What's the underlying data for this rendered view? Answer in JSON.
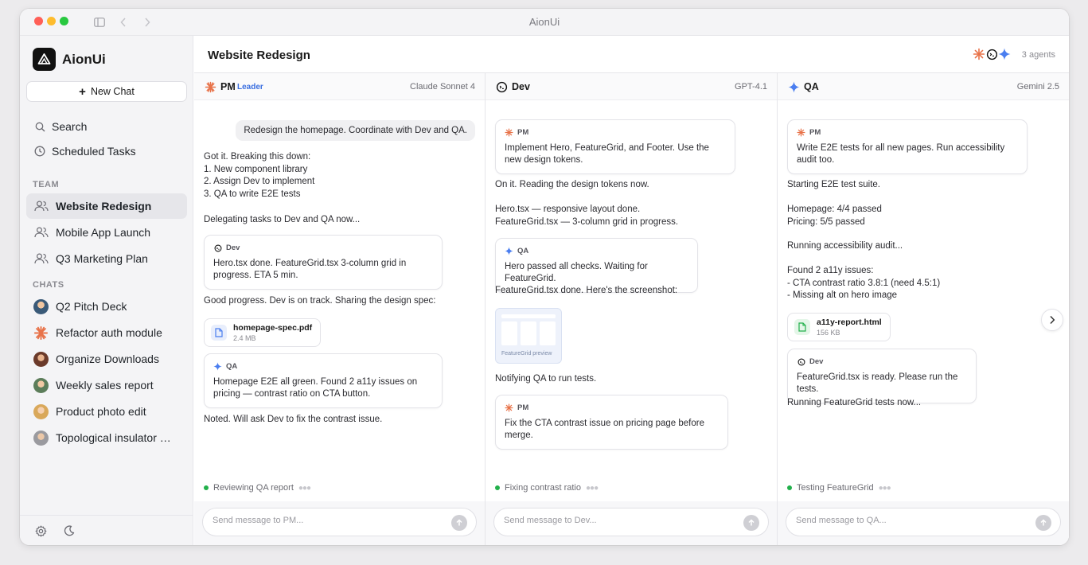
{
  "window": {
    "title": "AionUi"
  },
  "sidebar": {
    "brand": "AionUi",
    "new_chat": "New Chat",
    "nav": [
      {
        "label": "Search",
        "icon": "search-icon"
      },
      {
        "label": "Scheduled Tasks",
        "icon": "clock-icon"
      }
    ],
    "team_label": "TEAM",
    "teams": [
      {
        "label": "Website Redesign",
        "active": true
      },
      {
        "label": "Mobile App Launch"
      },
      {
        "label": "Q3 Marketing Plan"
      }
    ],
    "chats_label": "CHATS",
    "chats": [
      {
        "label": "Q2 Pitch Deck",
        "avatar": "avatar-man"
      },
      {
        "label": "Refactor auth module",
        "avatar": "claude-icon"
      },
      {
        "label": "Organize Downloads",
        "avatar": "avatar-woman"
      },
      {
        "label": "Weekly sales report",
        "avatar": "avatar-glasses"
      },
      {
        "label": "Product photo edit",
        "avatar": "avatar-blonde"
      },
      {
        "label": "Topological insulator p…",
        "avatar": "avatar-elder"
      }
    ]
  },
  "main": {
    "title": "Website Redesign",
    "agents_count": "3 agents",
    "columns": [
      {
        "name": "PM",
        "badge": "Leader",
        "model": "Claude Sonnet 4",
        "user_message": "Redesign the homepage. Coordinate with Dev and QA.",
        "m1": "Got it. Breaking this down:\n1. New component library\n2. Assign Dev to implement\n3. QA to write E2E tests",
        "m2": "Delegating tasks to Dev and QA now...",
        "b1_from": "Dev",
        "b1_text": "Hero.tsx done. FeatureGrid.tsx 3-column grid in progress. ETA 5 min.",
        "m3": "Good progress. Dev is on track. Sharing the design spec:",
        "file_name": "homepage-spec.pdf",
        "file_size": "2.4 MB",
        "b2_from": "QA",
        "b2_text": "Homepage E2E all green. Found 2 a11y issues on pricing — contrast ratio on CTA button.",
        "m4": "Noted. Will ask Dev to fix the contrast issue.",
        "status": "Reviewing QA report",
        "placeholder": "Send message to PM..."
      },
      {
        "name": "Dev",
        "model": "GPT-4.1",
        "b1_from": "PM",
        "b1_text": "Implement Hero, FeatureGrid, and Footer. Use the new design tokens.",
        "m1": "On it. Reading the design tokens now.",
        "m2": "Hero.tsx — responsive layout done.\nFeatureGrid.tsx — 3-column grid in progress.",
        "b2_from": "QA",
        "b2_text": "Hero passed all checks. Waiting for FeatureGrid.",
        "m3": "FeatureGrid.tsx done. Here's the screenshot:",
        "image_caption": "FeatureGrid preview",
        "m4": "Notifying QA to run tests.",
        "b3_from": "PM",
        "b3_text": "Fix the CTA contrast issue on pricing page before merge.",
        "status": "Fixing contrast ratio",
        "placeholder": "Send message to Dev..."
      },
      {
        "name": "QA",
        "model": "Gemini 2.5",
        "b1_from": "PM",
        "b1_text": "Write E2E tests for all new pages. Run accessibility audit too.",
        "m1": "Starting E2E test suite.",
        "m2": "Homepage: 4/4 passed\nPricing: 5/5 passed",
        "m3": "Running accessibility audit...",
        "m4": "Found 2 a11y issues:\n- CTA contrast ratio 3.8:1 (need 4.5:1)\n- Missing alt on hero image",
        "file_name": "a11y-report.html",
        "file_size": "156 KB",
        "b2_from": "Dev",
        "b2_text": "FeatureGrid.tsx is ready. Please run the tests.",
        "m5": "Running FeatureGrid tests now...",
        "status": "Testing FeatureGrid",
        "placeholder": "Send message to QA..."
      }
    ]
  },
  "colors": {
    "claude": "#e8734a",
    "gemini": "#4a7ef0",
    "leader": "#3b6fe0",
    "online": "#22b04b"
  }
}
